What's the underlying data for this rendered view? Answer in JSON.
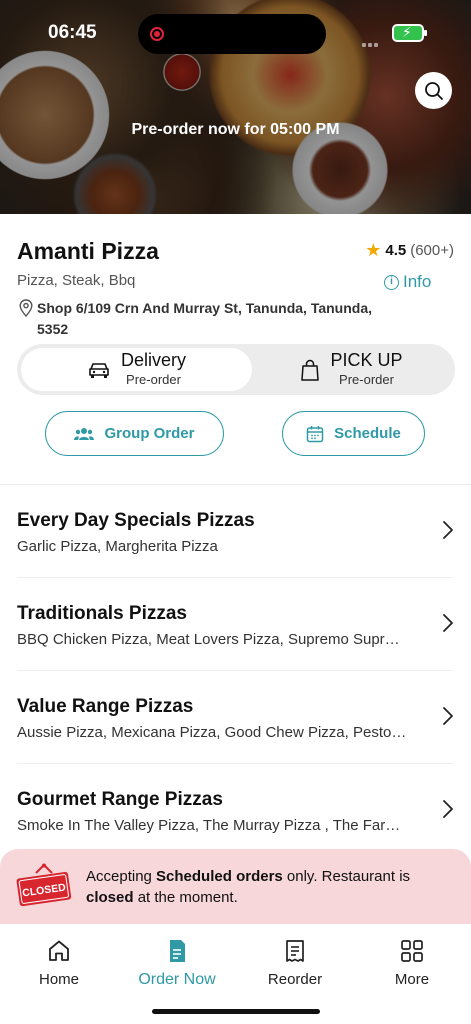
{
  "status_bar": {
    "time": "06:45"
  },
  "hero": {
    "banner_text": "Pre-order now for 05:00 PM"
  },
  "restaurant": {
    "name": "Amanti Pizza",
    "rating": "4.5",
    "rating_count": "(600+)",
    "cuisines": "Pizza, Steak, Bbq",
    "info_label": "Info",
    "address": "Shop 6/109 Crn And Murray St, Tanunda, Tanunda, 5352"
  },
  "order_type": {
    "delivery": {
      "title": "Delivery",
      "subtitle": "Pre-order",
      "selected": true
    },
    "pickup": {
      "title": "PICK UP",
      "subtitle": "Pre-order",
      "selected": false
    }
  },
  "actions": {
    "group_order": "Group Order",
    "schedule": "Schedule"
  },
  "categories": [
    {
      "title": "Every Day Specials Pizzas",
      "items": "Garlic Pizza, Margherita Pizza"
    },
    {
      "title": "Traditionals Pizzas",
      "items": "BBQ Chicken Pizza, Meat Lovers Pizza, Supremo Supr…"
    },
    {
      "title": "Value Range Pizzas",
      "items": "Aussie Pizza, Mexicana Pizza, Good Chew Pizza, Pesto…"
    },
    {
      "title": "Gourmet Range Pizzas",
      "items": "Smoke In The Valley Pizza, The Murray Pizza , The Far…"
    }
  ],
  "closed_notice": {
    "sign_text": "CLOSED",
    "part1": "Accepting ",
    "bold1": "Scheduled orders",
    "part2": " only. Restaurant is ",
    "bold2": "closed",
    "part3": " at the moment."
  },
  "tabs": [
    {
      "label": "Home",
      "icon": "home-icon",
      "active": false
    },
    {
      "label": "Order Now",
      "icon": "order-now-icon",
      "active": true
    },
    {
      "label": "Reorder",
      "icon": "receipt-icon",
      "active": false
    },
    {
      "label": "More",
      "icon": "grid-icon",
      "active": false
    }
  ],
  "colors": {
    "accent": "#2f9aa6",
    "closed_bg": "#f8d7da",
    "star": "#f2a900",
    "closed_red": "#d8262f"
  }
}
